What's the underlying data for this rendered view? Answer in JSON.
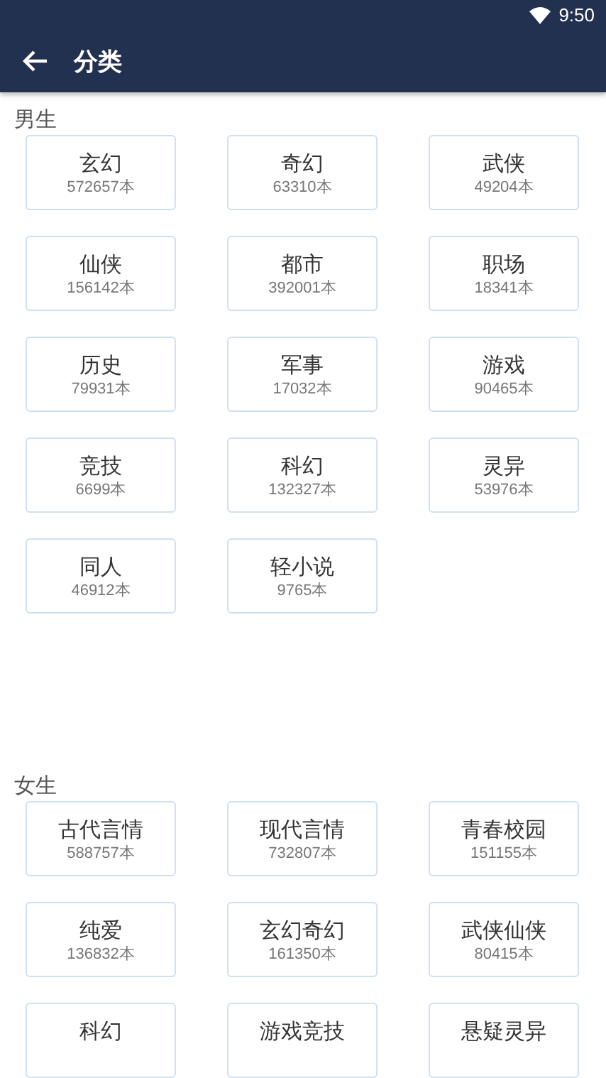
{
  "status_bar": {
    "time": "9:50"
  },
  "toolbar": {
    "title": "分类"
  },
  "sections": [
    {
      "title": "男生",
      "categories": [
        {
          "name": "玄幻",
          "count": "572657本"
        },
        {
          "name": "奇幻",
          "count": "63310本"
        },
        {
          "name": "武侠",
          "count": "49204本"
        },
        {
          "name": "仙侠",
          "count": "156142本"
        },
        {
          "name": "都市",
          "count": "392001本"
        },
        {
          "name": "职场",
          "count": "18341本"
        },
        {
          "name": "历史",
          "count": "79931本"
        },
        {
          "name": "军事",
          "count": "17032本"
        },
        {
          "name": "游戏",
          "count": "90465本"
        },
        {
          "name": "竞技",
          "count": "6699本"
        },
        {
          "name": "科幻",
          "count": "132327本"
        },
        {
          "name": "灵异",
          "count": "53976本"
        },
        {
          "name": "同人",
          "count": "46912本"
        },
        {
          "name": "轻小说",
          "count": "9765本"
        }
      ]
    },
    {
      "title": "女生",
      "categories": [
        {
          "name": "古代言情",
          "count": "588757本"
        },
        {
          "name": "现代言情",
          "count": "732807本"
        },
        {
          "name": "青春校园",
          "count": "151155本"
        },
        {
          "name": "纯爱",
          "count": "136832本"
        },
        {
          "name": "玄幻奇幻",
          "count": "161350本"
        },
        {
          "name": "武侠仙侠",
          "count": "80415本"
        },
        {
          "name": "科幻"
        },
        {
          "name": "游戏竞技"
        },
        {
          "name": "悬疑灵异"
        }
      ]
    }
  ]
}
